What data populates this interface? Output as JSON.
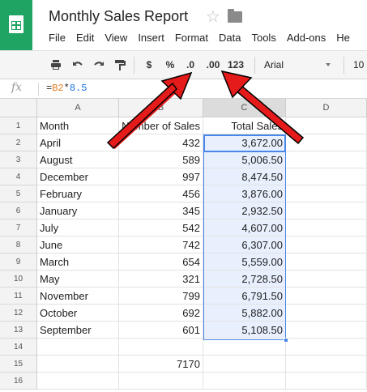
{
  "doc": {
    "title": "Monthly Sales Report"
  },
  "menu": [
    "File",
    "Edit",
    "View",
    "Insert",
    "Format",
    "Data",
    "Tools",
    "Add-ons",
    "He"
  ],
  "toolbar": {
    "currency": "$",
    "percent": "%",
    "decrease_decimal": ".0",
    "increase_decimal": ".00",
    "more_formats": "123",
    "font": "Arial",
    "font_size": "10"
  },
  "formula_bar": {
    "fx": "fx",
    "eq": "=",
    "ref": "B2",
    "op": "*",
    "num": "8.5"
  },
  "columns": [
    "A",
    "B",
    "C",
    "D"
  ],
  "rows": [
    {
      "n": "1",
      "a": "Month",
      "b": "Number of Sales",
      "c": "Total Sales"
    },
    {
      "n": "2",
      "a": "April",
      "b": "432",
      "c": "3,672.00"
    },
    {
      "n": "3",
      "a": "August",
      "b": "589",
      "c": "5,006.50"
    },
    {
      "n": "4",
      "a": "December",
      "b": "997",
      "c": "8,474.50"
    },
    {
      "n": "5",
      "a": "February",
      "b": "456",
      "c": "3,876.00"
    },
    {
      "n": "6",
      "a": "January",
      "b": "345",
      "c": "2,932.50"
    },
    {
      "n": "7",
      "a": "July",
      "b": "542",
      "c": "4,607.00"
    },
    {
      "n": "8",
      "a": "June",
      "b": "742",
      "c": "6,307.00"
    },
    {
      "n": "9",
      "a": "March",
      "b": "654",
      "c": "5,559.00"
    },
    {
      "n": "10",
      "a": "May",
      "b": "321",
      "c": "2,728.50"
    },
    {
      "n": "11",
      "a": "November",
      "b": "799",
      "c": "6,791.50"
    },
    {
      "n": "12",
      "a": "October",
      "b": "692",
      "c": "5,882.00"
    },
    {
      "n": "13",
      "a": "September",
      "b": "601",
      "c": "5,108.50"
    },
    {
      "n": "14",
      "a": "",
      "b": "",
      "c": ""
    },
    {
      "n": "15",
      "a": "",
      "b": "7170",
      "c": ""
    },
    {
      "n": "16",
      "a": "",
      "b": "",
      "c": ""
    }
  ],
  "colors": {
    "sheets_green": "#1fa463",
    "selection": "#4a86e8",
    "arrow": "#e51b1b"
  }
}
